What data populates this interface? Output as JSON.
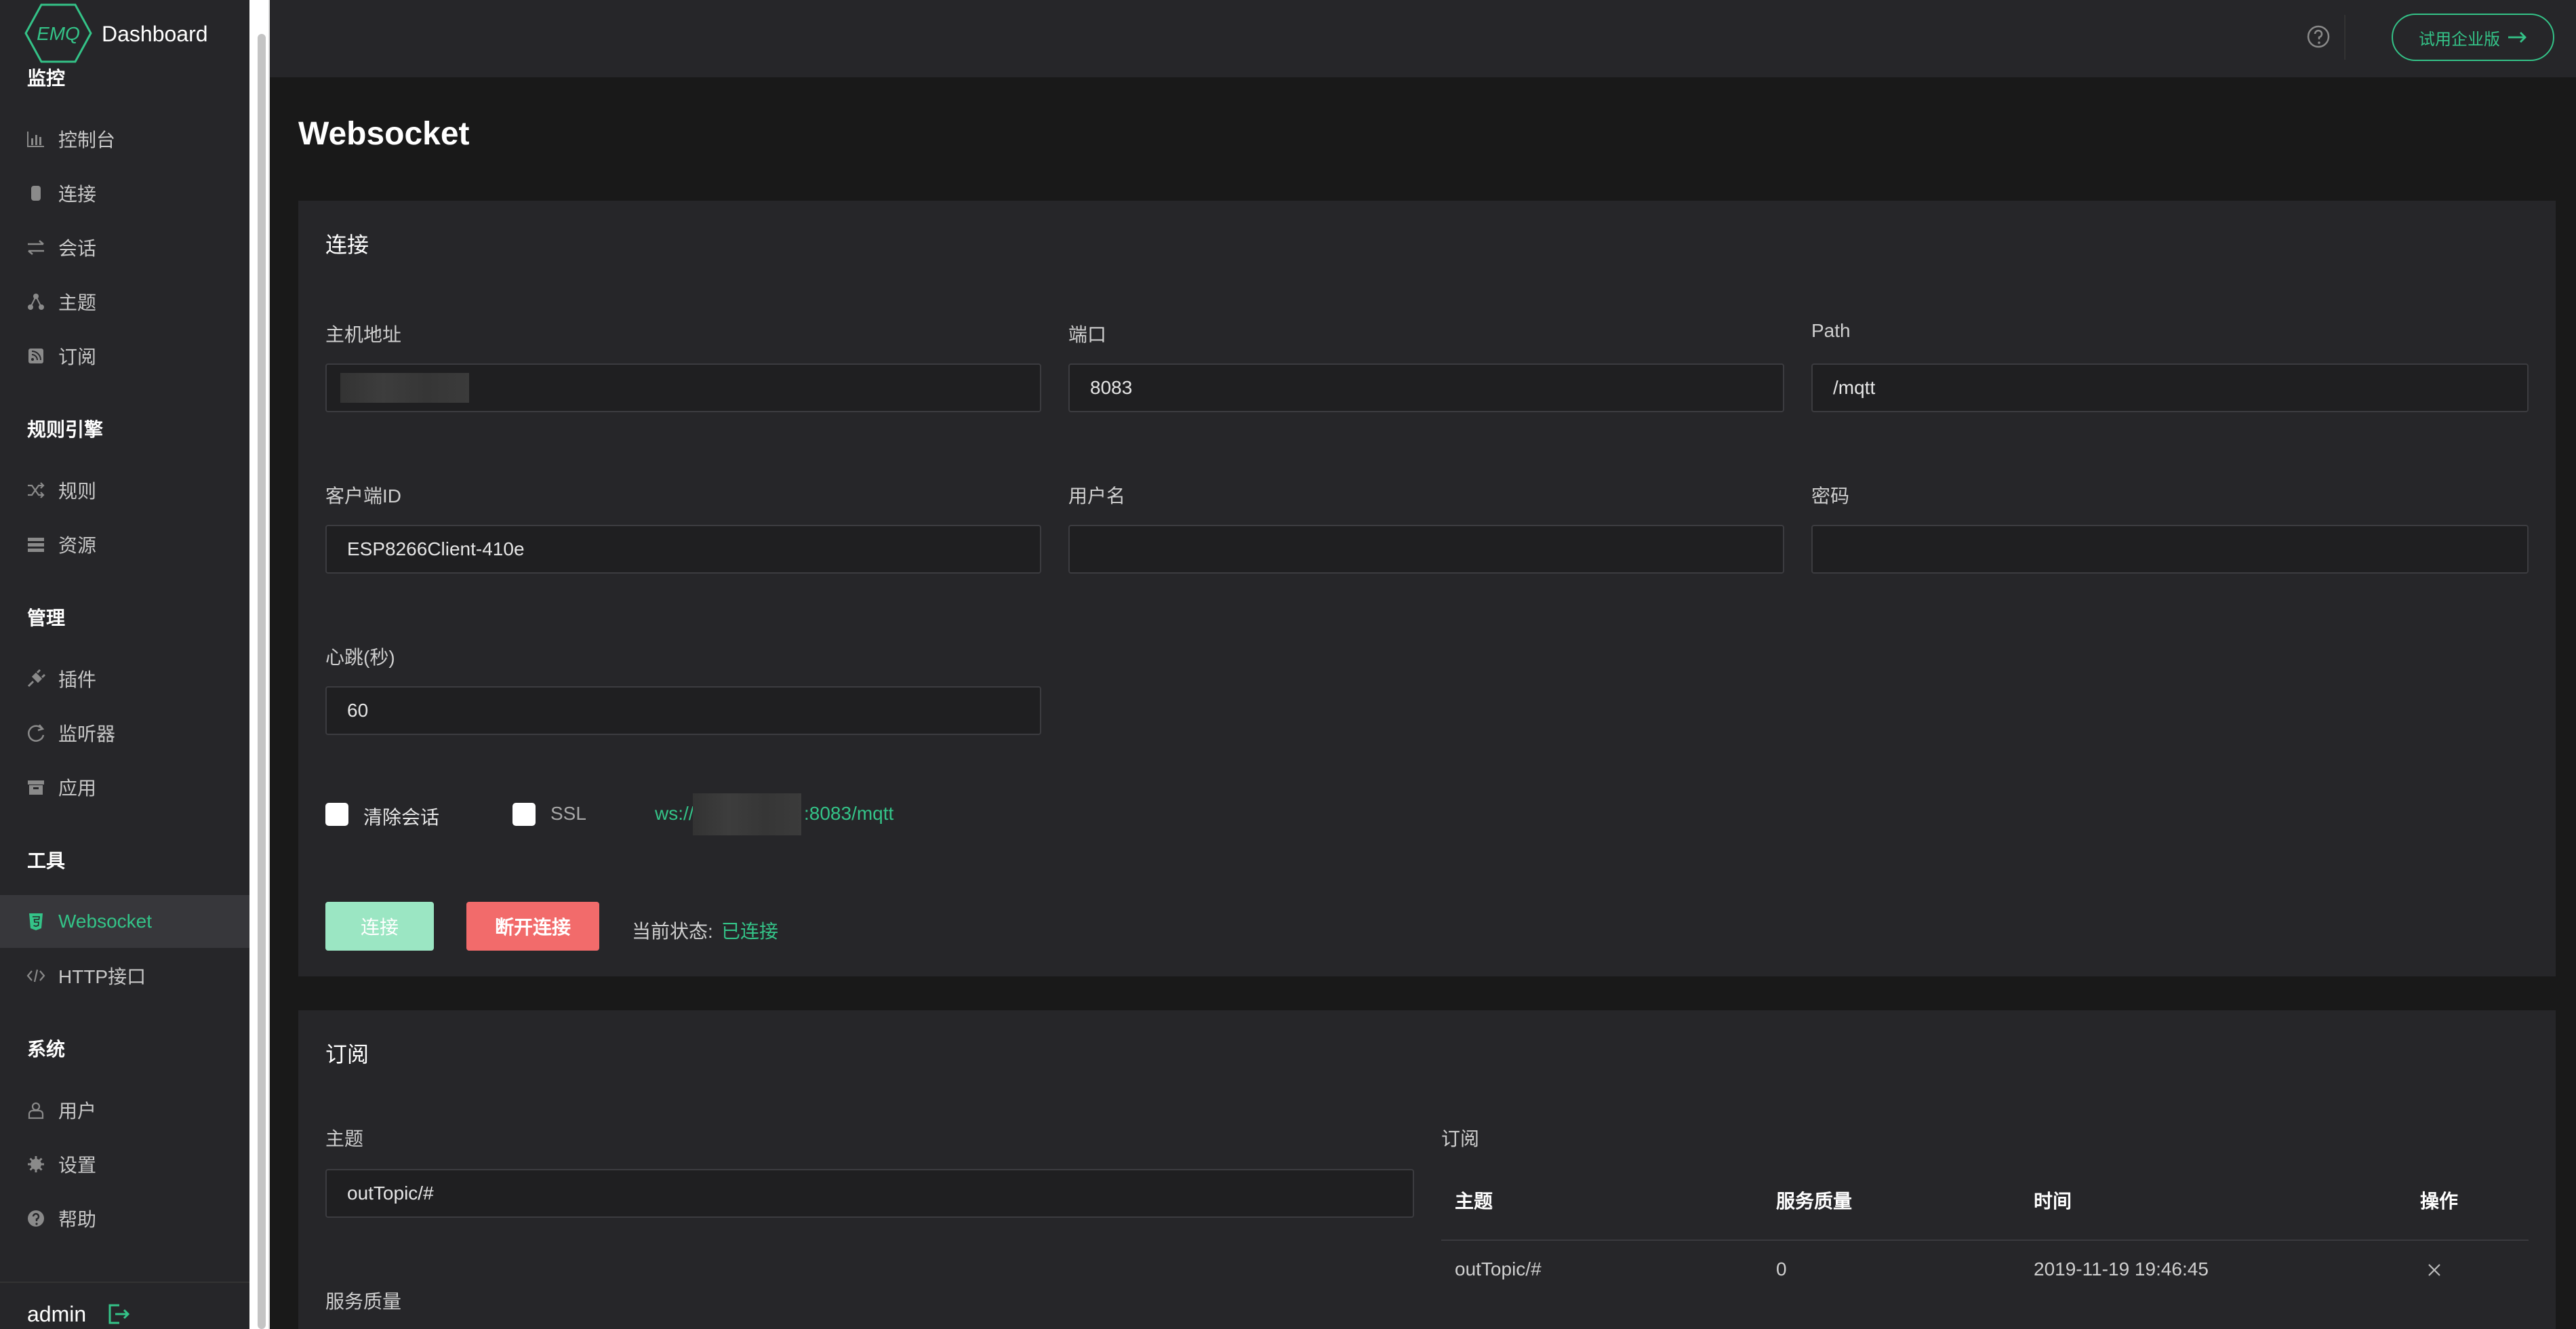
{
  "app": {
    "logo_text": "EMQ",
    "title": "Dashboard",
    "user": "admin"
  },
  "header": {
    "trial_button": "试用企业版"
  },
  "sidebar": {
    "partial_heading": "监控",
    "items_monitor": [
      {
        "label": "控制台",
        "icon": "bar-chart-icon"
      },
      {
        "label": "连接",
        "icon": "cylinder-icon"
      },
      {
        "label": "会话",
        "icon": "swap-icon"
      },
      {
        "label": "主题",
        "icon": "topic-icon"
      },
      {
        "label": "订阅",
        "icon": "rss-icon"
      }
    ],
    "heading_rules": "规则引擎",
    "items_rules": [
      {
        "label": "规则",
        "icon": "shuffle-icon"
      },
      {
        "label": "资源",
        "icon": "list-icon"
      }
    ],
    "heading_manage": "管理",
    "items_manage": [
      {
        "label": "插件",
        "icon": "plug-icon"
      },
      {
        "label": "监听器",
        "icon": "refresh-icon"
      },
      {
        "label": "应用",
        "icon": "archive-icon"
      }
    ],
    "heading_tools": "工具",
    "items_tools": [
      {
        "label": "Websocket",
        "icon": "html5-icon",
        "active": true
      },
      {
        "label": "HTTP接口",
        "icon": "code-icon"
      }
    ],
    "heading_system": "系统",
    "items_system": [
      {
        "label": "用户",
        "icon": "user-icon"
      },
      {
        "label": "设置",
        "icon": "gear-icon"
      },
      {
        "label": "帮助",
        "icon": "question-icon"
      }
    ]
  },
  "page": {
    "title": "Websocket"
  },
  "connect": {
    "title": "连接",
    "host_label": "主机地址",
    "host_value": "",
    "port_label": "端口",
    "port_value": "8083",
    "path_label": "Path",
    "path_value": "/mqtt",
    "client_id_label": "客户端ID",
    "client_id_value": "ESP8266Client-410e",
    "username_label": "用户名",
    "username_value": "",
    "password_label": "密码",
    "password_value": "",
    "keepalive_label": "心跳(秒)",
    "keepalive_value": "60",
    "clean_session_label": "清除会话",
    "ssl_label": "SSL",
    "url_prefix": "ws://",
    "url_suffix": ":8083/mqtt",
    "connect_button": "连接",
    "disconnect_button": "断开连接",
    "status_label": "当前状态:",
    "status_value": "已连接"
  },
  "subscribe": {
    "title": "订阅",
    "topic_label": "主题",
    "topic_value": "outTopic/#",
    "qos_label": "服务质量",
    "list_title": "订阅",
    "columns": [
      "主题",
      "服务质量",
      "时间",
      "操作"
    ],
    "rows": [
      {
        "topic": "outTopic/#",
        "qos": "0",
        "time": "2019-11-19 19:46:45"
      }
    ]
  },
  "colors": {
    "accent": "#34c388",
    "danger": "#f26b6b",
    "sidebar_bg": "#262629",
    "page_bg": "#191919"
  }
}
